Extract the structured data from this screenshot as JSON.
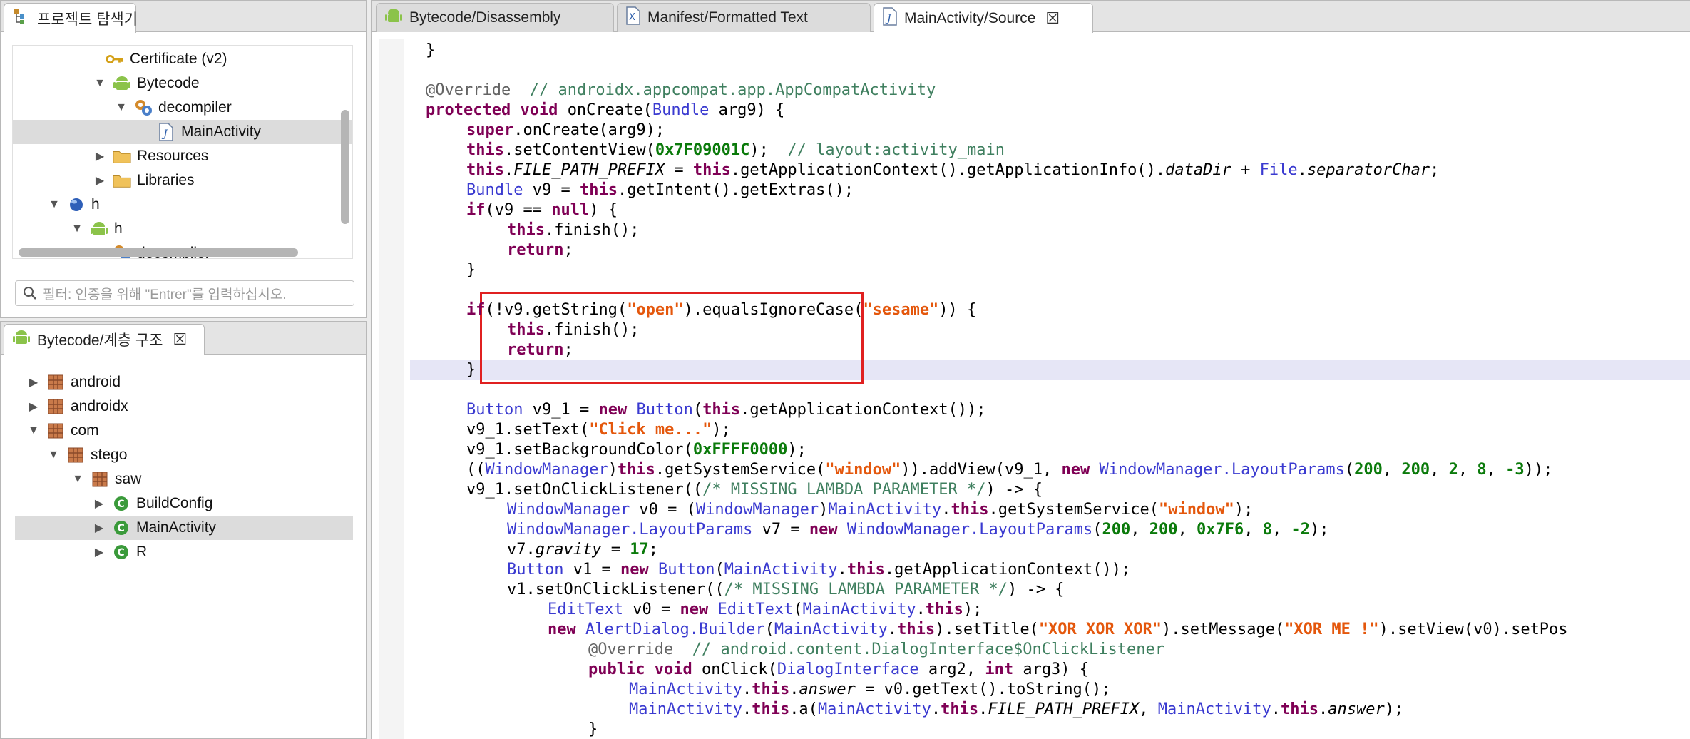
{
  "project_explorer": {
    "title": "프로젝트 탐색기",
    "tree": [
      "Certificate (v2)",
      "Bytecode",
      "decompiler",
      "MainActivity",
      "Resources",
      "Libraries",
      "h",
      "h",
      "decompiler"
    ],
    "filter_placeholder": "필터: 인증을 위해 \"Entrer\"를 입력하십시오."
  },
  "hierarchy": {
    "title": "Bytecode/계층 구조",
    "tree": [
      "android",
      "androidx",
      "com",
      "stego",
      "saw",
      "BuildConfig",
      "MainActivity",
      "R"
    ]
  },
  "editor": {
    "tabs": [
      "Bytecode/Disassembly",
      "Manifest/Formatted Text",
      "MainActivity/Source"
    ],
    "active_tab": "MainActivity/Source",
    "highlight_color": "#e02020",
    "code": {
      "l0": "}",
      "l2_ann": "@Override",
      "l2_cm": "// androidx.appcompat.app.AppCompatActivity",
      "l3_a": "protected void",
      "l3_b": "onCreate(",
      "l3_c": "Bundle",
      "l3_d": "arg9) {",
      "l4_a": "super",
      "l4_b": ".onCreate(arg9);",
      "l5_a": "this",
      "l5_b": ".setContentView(",
      "l5_c": "0x7F09001C",
      "l5_d": ");",
      "l5_cm": "// layout:activity_main",
      "l6_a": "this",
      "l6_b": ".",
      "l6_c": "FILE_PATH_PREFIX",
      "l6_d": " = ",
      "l6_e": "this",
      "l6_f": ".getApplicationContext().getApplicationInfo().",
      "l6_g": "dataDir",
      "l6_h": " + ",
      "l6_i": "File",
      "l6_j": ".",
      "l6_k": "separatorChar",
      "l6_l": ";",
      "l7_a": "Bundle",
      "l7_b": " v9 = ",
      "l7_c": "this",
      "l7_d": ".getIntent().getExtras();",
      "l8_a": "if",
      "l8_b": "(v9 == ",
      "l8_c": "null",
      "l8_d": ") {",
      "l9_a": "this",
      "l9_b": ".finish();",
      "l10_a": "return",
      "l10_b": ";",
      "l11": "}",
      "l13_a": "if",
      "l13_b": "(!v9.getString(",
      "l13_c": "\"open\"",
      "l13_d": ").equalsIgnoreCase(",
      "l13_e": "\"sesame\"",
      "l13_f": ")) {",
      "l14_a": "this",
      "l14_b": ".finish();",
      "l15_a": "return",
      "l15_b": ";",
      "l16": "}",
      "l18_a": "Button",
      "l18_b": " v9_1 = ",
      "l18_c": "new",
      "l18_d": " ",
      "l18_e": "Button",
      "l18_f": "(",
      "l18_g": "this",
      "l18_h": ".getApplicationContext());",
      "l19_a": "v9_1.setText(",
      "l19_b": "\"Click me...\"",
      "l19_c": ");",
      "l20_a": "v9_1.setBackgroundColor(",
      "l20_b": "0xFFFF0000",
      "l20_c": ");",
      "l21_a": "((",
      "l21_b": "WindowManager",
      "l21_c": ")",
      "l21_d": "this",
      "l21_e": ".getSystemService(",
      "l21_f": "\"window\"",
      "l21_g": ")).addView(v9_1, ",
      "l21_h": "new",
      "l21_i": " ",
      "l21_j": "WindowManager.LayoutParams",
      "l21_k": "(",
      "l21_l": "200",
      "l21_m": ", ",
      "l21_n": "200",
      "l21_o": ", ",
      "l21_p": "2",
      "l21_q": ", ",
      "l21_r": "8",
      "l21_s": ", ",
      "l21_t": "-3",
      "l21_u": "));",
      "l22_a": "v9_1.setOnClickListener((",
      "l22_b": "/* MISSING LAMBDA PARAMETER */",
      "l22_c": ") -> {",
      "l23_a": "WindowManager",
      "l23_b": " v0 = (",
      "l23_c": "WindowManager",
      "l23_d": ")",
      "l23_e": "MainActivity",
      "l23_f": ".",
      "l23_g": "this",
      "l23_h": ".getSystemService(",
      "l23_i": "\"window\"",
      "l23_j": ");",
      "l24_a": "WindowManager.LayoutParams",
      "l24_b": " v7 = ",
      "l24_c": "new",
      "l24_d": " ",
      "l24_e": "WindowManager.LayoutParams",
      "l24_f": "(",
      "l24_g": "200",
      "l24_h": ", ",
      "l24_i": "200",
      "l24_j": ", ",
      "l24_k": "0x7F6",
      "l24_l": ", ",
      "l24_m": "8",
      "l24_n": ", ",
      "l24_o": "-2",
      "l24_p": ");",
      "l25_a": "v7.",
      "l25_b": "gravity",
      "l25_c": " = ",
      "l25_d": "17",
      "l25_e": ";",
      "l26_a": "Button",
      "l26_b": " v1 = ",
      "l26_c": "new",
      "l26_d": " ",
      "l26_e": "Button",
      "l26_f": "(",
      "l26_g": "MainActivity",
      "l26_h": ".",
      "l26_i": "this",
      "l26_j": ".getApplicationContext());",
      "l27_a": "v1.setOnClickListener((",
      "l27_b": "/* MISSING LAMBDA PARAMETER */",
      "l27_c": ") -> {",
      "l28_a": "EditText",
      "l28_b": " v0 = ",
      "l28_c": "new",
      "l28_d": " ",
      "l28_e": "EditText",
      "l28_f": "(",
      "l28_g": "MainActivity",
      "l28_h": ".",
      "l28_i": "this",
      "l28_j": ");",
      "l29_a": "new",
      "l29_b": " ",
      "l29_c": "AlertDialog.Builder",
      "l29_d": "(",
      "l29_e": "MainActivity",
      "l29_f": ".",
      "l29_g": "this",
      "l29_h": ").setTitle(",
      "l29_i": "\"XOR XOR XOR\"",
      "l29_j": ").setMessage(",
      "l29_k": "\"XOR ME !\"",
      "l29_l": ").setView(v0).setPos",
      "l30_a": "@Override",
      "l30_b": "// android.content.DialogInterface$OnClickListener",
      "l31_a": "public void",
      "l31_b": " onClick(",
      "l31_c": "DialogInterface",
      "l31_d": " arg2, ",
      "l31_e": "int",
      "l31_f": " arg3) {",
      "l32_a": "MainActivity",
      "l32_b": ".",
      "l32_c": "this",
      "l32_d": ".",
      "l32_e": "answer",
      "l32_f": " = v0.getText().toString();",
      "l33_a": "MainActivity",
      "l33_b": ".",
      "l33_c": "this",
      "l33_d": ".a(",
      "l33_e": "MainActivity",
      "l33_f": ".",
      "l33_g": "this",
      "l33_h": ".",
      "l33_i": "FILE_PATH_PREFIX",
      "l33_j": ", ",
      "l33_k": "MainActivity",
      "l33_l": ".",
      "l33_m": "this",
      "l33_n": ".",
      "l33_o": "answer",
      "l33_p": ");",
      "l34": "}"
    }
  }
}
